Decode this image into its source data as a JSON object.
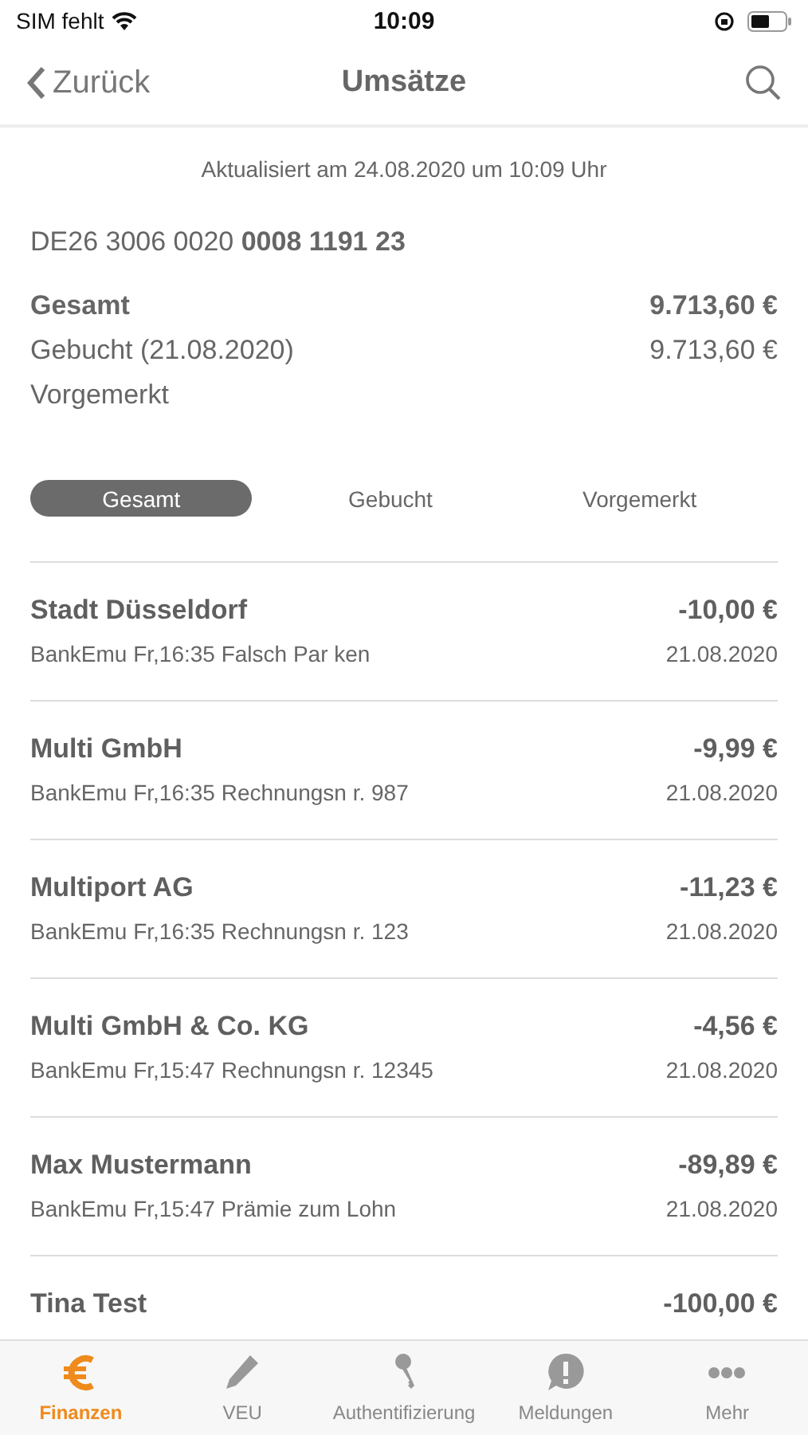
{
  "status_bar": {
    "carrier": "SIM fehlt",
    "time": "10:09"
  },
  "nav": {
    "back": "Zurück",
    "title": "Umsätze"
  },
  "updated": "Aktualisiert am 24.08.2020 um 10:09 Uhr",
  "account": "DE26 3006 0020 **0008 1191 23**",
  "balances": [
    {
      "kind": "total",
      "label": "Gesamt",
      "amount": "9.713,60 €"
    },
    {
      "kind": "line",
      "label": "Gebucht (21.08.2020)",
      "amount": "9.713,60 €"
    },
    {
      "kind": "line",
      "label": "Vorgemerkt"
    }
  ],
  "filters": [
    {
      "label": "Gesamt",
      "selected": true
    },
    {
      "label": "Gebucht",
      "selected": false
    },
    {
      "label": "Vorgemerkt",
      "selected": false
    }
  ],
  "transactions": [
    {
      "name": "Stadt Düsseldorf",
      "amount": "-10,00 €",
      "detail": "BankEmu Fr,16:35 Falsch Par ken",
      "date": "21.08.2020"
    },
    {
      "name": "Multi GmbH",
      "amount": "-9,99 €",
      "detail": "BankEmu Fr,16:35 Rechnungsn r. 987",
      "date": "21.08.2020"
    },
    {
      "name": "Multiport AG",
      "amount": "-11,23 €",
      "detail": "BankEmu Fr,16:35 Rechnungsn r. 123",
      "date": "21.08.2020"
    },
    {
      "name": "Multi GmbH & Co. KG",
      "amount": "-4,56 €",
      "detail": "BankEmu Fr,15:47 Rechnungsn r. 12345",
      "date": "21.08.2020"
    },
    {
      "name": "Max Mustermann",
      "amount": "-89,89 €",
      "detail": "BankEmu Fr,15:47 Prämie zum Lohn",
      "date": "21.08.2020"
    },
    {
      "name": "Tina Test",
      "amount": "-100,00 €"
    }
  ],
  "tab_bar": [
    {
      "label": "Finanzen",
      "selected": true
    },
    {
      "label": "VEU",
      "selected": false
    },
    {
      "label": "Authentifizierung",
      "selected": false
    },
    {
      "label": "Meldungen",
      "selected": false
    },
    {
      "label": "Mehr",
      "selected": false
    }
  ]
}
